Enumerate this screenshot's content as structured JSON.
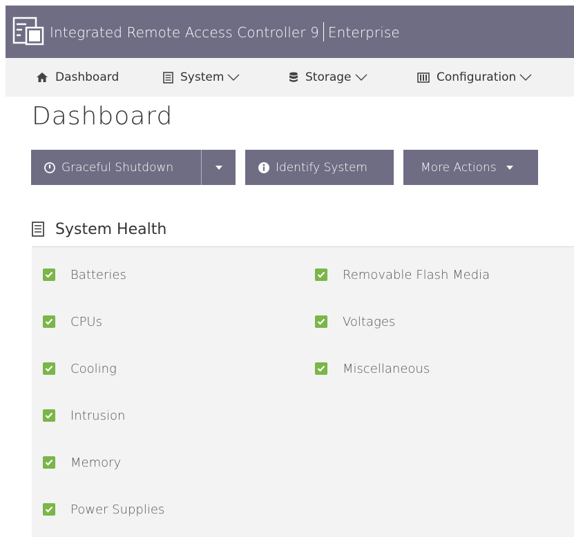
{
  "header": {
    "title": "Integrated Remote Access Controller 9",
    "edition": "Enterprise",
    "logo_icon": "server-rack-icon",
    "background": "#6e6d84"
  },
  "nav": {
    "items": [
      {
        "label": "Dashboard",
        "icon": "home-icon"
      },
      {
        "label": "System",
        "icon": "server-icon"
      },
      {
        "label": "Storage",
        "icon": "database-icon"
      },
      {
        "label": "Configuration",
        "icon": "sliders-icon"
      }
    ]
  },
  "page": {
    "title": "Dashboard"
  },
  "actions": {
    "graceful_shutdown": "Graceful Shutdown",
    "identify_system": "Identify System",
    "more_actions": "More Actions"
  },
  "health": {
    "title": "System Health",
    "status_color": "#7ab648",
    "left_items": [
      "Batteries",
      "CPUs",
      "Cooling",
      "Intrusion",
      "Memory",
      "Power Supplies"
    ],
    "right_items": [
      "Removable Flash Media",
      "Voltages",
      "Miscellaneous"
    ]
  }
}
